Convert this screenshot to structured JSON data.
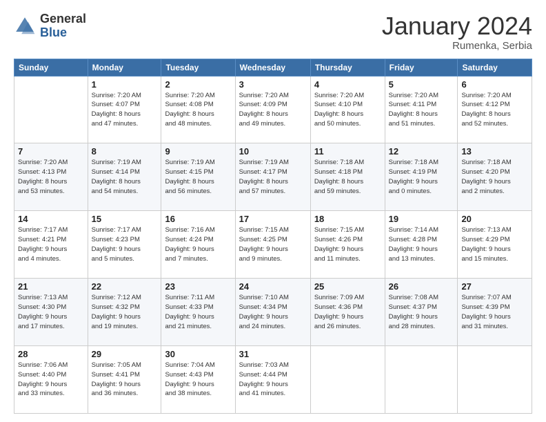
{
  "header": {
    "logo_general": "General",
    "logo_blue": "Blue",
    "month_title": "January 2024",
    "subtitle": "Rumenka, Serbia"
  },
  "weekdays": [
    "Sunday",
    "Monday",
    "Tuesday",
    "Wednesday",
    "Thursday",
    "Friday",
    "Saturday"
  ],
  "weeks": [
    [
      {
        "day": "",
        "info": ""
      },
      {
        "day": "1",
        "info": "Sunrise: 7:20 AM\nSunset: 4:07 PM\nDaylight: 8 hours\nand 47 minutes."
      },
      {
        "day": "2",
        "info": "Sunrise: 7:20 AM\nSunset: 4:08 PM\nDaylight: 8 hours\nand 48 minutes."
      },
      {
        "day": "3",
        "info": "Sunrise: 7:20 AM\nSunset: 4:09 PM\nDaylight: 8 hours\nand 49 minutes."
      },
      {
        "day": "4",
        "info": "Sunrise: 7:20 AM\nSunset: 4:10 PM\nDaylight: 8 hours\nand 50 minutes."
      },
      {
        "day": "5",
        "info": "Sunrise: 7:20 AM\nSunset: 4:11 PM\nDaylight: 8 hours\nand 51 minutes."
      },
      {
        "day": "6",
        "info": "Sunrise: 7:20 AM\nSunset: 4:12 PM\nDaylight: 8 hours\nand 52 minutes."
      }
    ],
    [
      {
        "day": "7",
        "info": "Sunrise: 7:20 AM\nSunset: 4:13 PM\nDaylight: 8 hours\nand 53 minutes."
      },
      {
        "day": "8",
        "info": "Sunrise: 7:19 AM\nSunset: 4:14 PM\nDaylight: 8 hours\nand 54 minutes."
      },
      {
        "day": "9",
        "info": "Sunrise: 7:19 AM\nSunset: 4:15 PM\nDaylight: 8 hours\nand 56 minutes."
      },
      {
        "day": "10",
        "info": "Sunrise: 7:19 AM\nSunset: 4:17 PM\nDaylight: 8 hours\nand 57 minutes."
      },
      {
        "day": "11",
        "info": "Sunrise: 7:18 AM\nSunset: 4:18 PM\nDaylight: 8 hours\nand 59 minutes."
      },
      {
        "day": "12",
        "info": "Sunrise: 7:18 AM\nSunset: 4:19 PM\nDaylight: 9 hours\nand 0 minutes."
      },
      {
        "day": "13",
        "info": "Sunrise: 7:18 AM\nSunset: 4:20 PM\nDaylight: 9 hours\nand 2 minutes."
      }
    ],
    [
      {
        "day": "14",
        "info": "Sunrise: 7:17 AM\nSunset: 4:21 PM\nDaylight: 9 hours\nand 4 minutes."
      },
      {
        "day": "15",
        "info": "Sunrise: 7:17 AM\nSunset: 4:23 PM\nDaylight: 9 hours\nand 5 minutes."
      },
      {
        "day": "16",
        "info": "Sunrise: 7:16 AM\nSunset: 4:24 PM\nDaylight: 9 hours\nand 7 minutes."
      },
      {
        "day": "17",
        "info": "Sunrise: 7:15 AM\nSunset: 4:25 PM\nDaylight: 9 hours\nand 9 minutes."
      },
      {
        "day": "18",
        "info": "Sunrise: 7:15 AM\nSunset: 4:26 PM\nDaylight: 9 hours\nand 11 minutes."
      },
      {
        "day": "19",
        "info": "Sunrise: 7:14 AM\nSunset: 4:28 PM\nDaylight: 9 hours\nand 13 minutes."
      },
      {
        "day": "20",
        "info": "Sunrise: 7:13 AM\nSunset: 4:29 PM\nDaylight: 9 hours\nand 15 minutes."
      }
    ],
    [
      {
        "day": "21",
        "info": "Sunrise: 7:13 AM\nSunset: 4:30 PM\nDaylight: 9 hours\nand 17 minutes."
      },
      {
        "day": "22",
        "info": "Sunrise: 7:12 AM\nSunset: 4:32 PM\nDaylight: 9 hours\nand 19 minutes."
      },
      {
        "day": "23",
        "info": "Sunrise: 7:11 AM\nSunset: 4:33 PM\nDaylight: 9 hours\nand 21 minutes."
      },
      {
        "day": "24",
        "info": "Sunrise: 7:10 AM\nSunset: 4:34 PM\nDaylight: 9 hours\nand 24 minutes."
      },
      {
        "day": "25",
        "info": "Sunrise: 7:09 AM\nSunset: 4:36 PM\nDaylight: 9 hours\nand 26 minutes."
      },
      {
        "day": "26",
        "info": "Sunrise: 7:08 AM\nSunset: 4:37 PM\nDaylight: 9 hours\nand 28 minutes."
      },
      {
        "day": "27",
        "info": "Sunrise: 7:07 AM\nSunset: 4:39 PM\nDaylight: 9 hours\nand 31 minutes."
      }
    ],
    [
      {
        "day": "28",
        "info": "Sunrise: 7:06 AM\nSunset: 4:40 PM\nDaylight: 9 hours\nand 33 minutes."
      },
      {
        "day": "29",
        "info": "Sunrise: 7:05 AM\nSunset: 4:41 PM\nDaylight: 9 hours\nand 36 minutes."
      },
      {
        "day": "30",
        "info": "Sunrise: 7:04 AM\nSunset: 4:43 PM\nDaylight: 9 hours\nand 38 minutes."
      },
      {
        "day": "31",
        "info": "Sunrise: 7:03 AM\nSunset: 4:44 PM\nDaylight: 9 hours\nand 41 minutes."
      },
      {
        "day": "",
        "info": ""
      },
      {
        "day": "",
        "info": ""
      },
      {
        "day": "",
        "info": ""
      }
    ]
  ]
}
